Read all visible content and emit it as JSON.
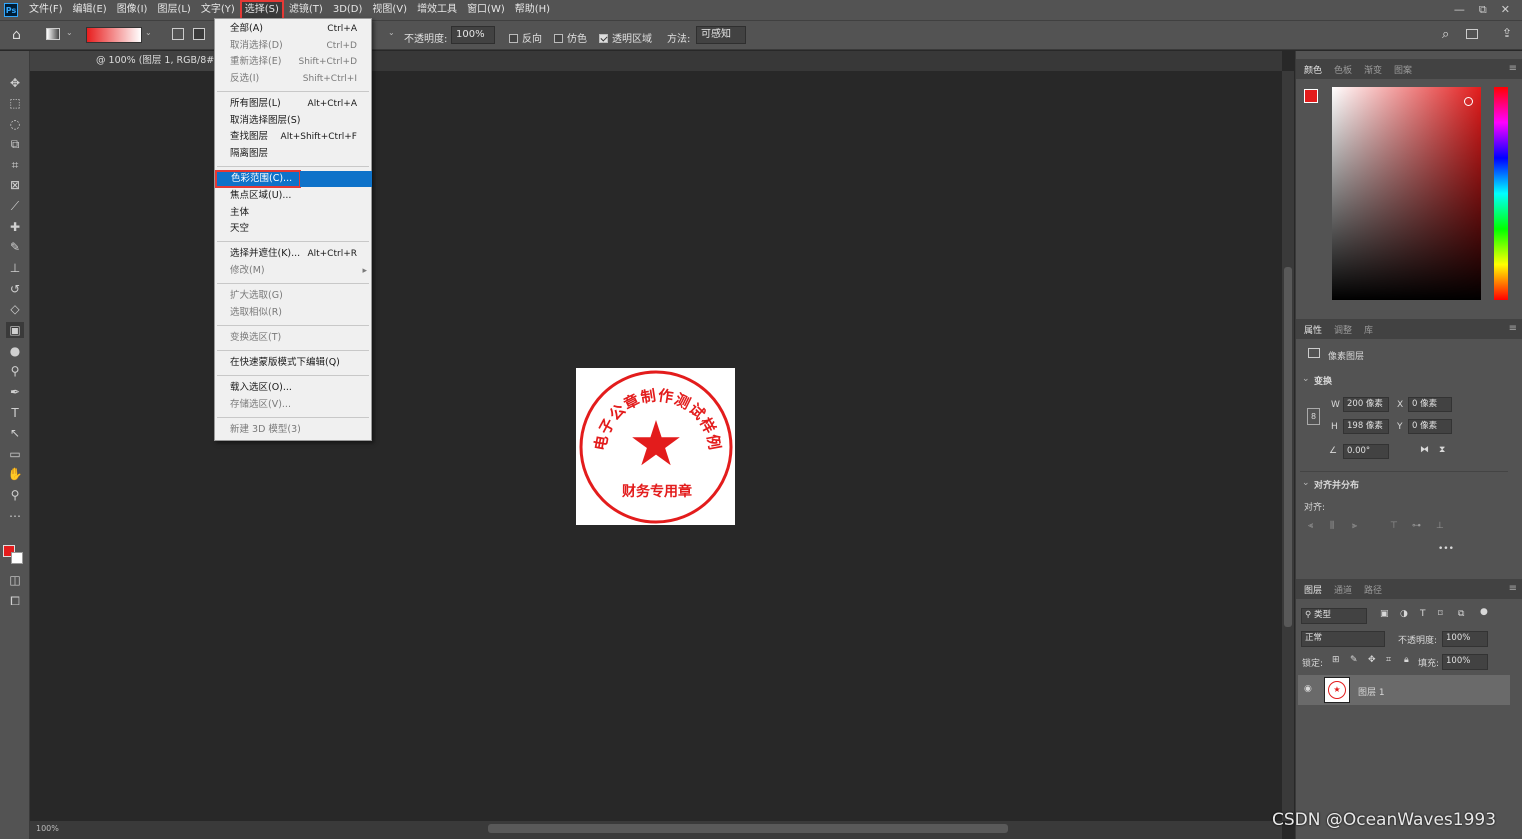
{
  "menubar": {
    "items": [
      "文件(F)",
      "编辑(E)",
      "图像(I)",
      "图层(L)",
      "文字(Y)",
      "选择(S)",
      "滤镜(T)",
      "3D(D)",
      "视图(V)",
      "增效工具",
      "窗口(W)",
      "帮助(H)"
    ],
    "active_index": 5,
    "window_controls": [
      "—",
      "⧉",
      "✕"
    ]
  },
  "options": {
    "opacity_label": "不透明度:",
    "opacity_value": "100%",
    "reverse_label": "反向",
    "dither_label": "仿色",
    "transparency_label": "透明区域",
    "method_label": "方法:",
    "method_value": "可感知"
  },
  "document": {
    "tab_title": "@ 100% (图层 1, RGB/8#)",
    "zoom": "100%"
  },
  "stamp": {
    "top_text": "电子公章制作测试样例",
    "bottom_text": "财务专用章",
    "color": "#e31c1c"
  },
  "select_menu": {
    "items": [
      {
        "label": "全部(A)",
        "shortcut": "Ctrl+A",
        "disabled": false
      },
      {
        "label": "取消选择(D)",
        "shortcut": "Ctrl+D",
        "disabled": true
      },
      {
        "label": "重新选择(E)",
        "shortcut": "Shift+Ctrl+D",
        "disabled": true
      },
      {
        "label": "反选(I)",
        "shortcut": "Shift+Ctrl+I",
        "disabled": true
      },
      {
        "label": "所有图层(L)",
        "shortcut": "Alt+Ctrl+A",
        "disabled": false
      },
      {
        "label": "取消选择图层(S)",
        "shortcut": "",
        "disabled": false
      },
      {
        "label": "查找图层",
        "shortcut": "Alt+Shift+Ctrl+F",
        "disabled": false
      },
      {
        "label": "隔离图层",
        "shortcut": "",
        "disabled": false
      },
      {
        "label": "色彩范围(C)...",
        "shortcut": "",
        "disabled": false,
        "highlighted": true
      },
      {
        "label": "焦点区域(U)...",
        "shortcut": "",
        "disabled": false
      },
      {
        "label": "主体",
        "shortcut": "",
        "disabled": false
      },
      {
        "label": "天空",
        "shortcut": "",
        "disabled": false
      },
      {
        "label": "选择并遮住(K)...",
        "shortcut": "Alt+Ctrl+R",
        "disabled": false
      },
      {
        "label": "修改(M)",
        "shortcut": "",
        "disabled": true,
        "submenu": true
      },
      {
        "label": "扩大选取(G)",
        "shortcut": "",
        "disabled": true
      },
      {
        "label": "选取相似(R)",
        "shortcut": "",
        "disabled": true
      },
      {
        "label": "变换选区(T)",
        "shortcut": "",
        "disabled": true
      },
      {
        "label": "在快速蒙版模式下编辑(Q)",
        "shortcut": "",
        "disabled": false
      },
      {
        "label": "载入选区(O)...",
        "shortcut": "",
        "disabled": false
      },
      {
        "label": "存储选区(V)...",
        "shortcut": "",
        "disabled": true
      },
      {
        "label": "新建 3D 模型(3)",
        "shortcut": "",
        "disabled": true
      }
    ]
  },
  "color_panel": {
    "tabs": [
      "颜色",
      "色板",
      "渐变",
      "图案"
    ],
    "foreground": "#e31c1c",
    "background": "#ffffff"
  },
  "properties_panel": {
    "tabs": [
      "属性",
      "调整",
      "库"
    ],
    "layer_type": "像素图层",
    "transform_title": "变换",
    "w_label": "W",
    "w_value": "200 像素",
    "h_label": "H",
    "h_value": "198 像素",
    "x_label": "X",
    "x_value": "0 像素",
    "y_label": "Y",
    "y_value": "0 像素",
    "angle_value": "0.00°",
    "align_title": "对齐并分布",
    "align_label": "对齐:",
    "more": "•••"
  },
  "layers_panel": {
    "tabs": [
      "图层",
      "通道",
      "路径"
    ],
    "filter_label": "类型",
    "blend_mode": "正常",
    "opacity_label": "不透明度:",
    "opacity_value": "100%",
    "lock_label": "锁定:",
    "fill_label": "填充:",
    "fill_value": "100%",
    "layer_name": "图层 1"
  },
  "watermark": "CSDN @OceanWaves1993"
}
